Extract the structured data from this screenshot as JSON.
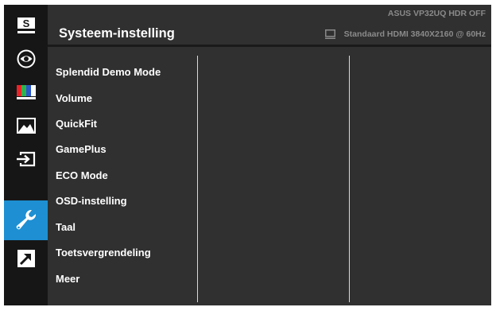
{
  "header": {
    "title": "Systeem-instelling",
    "model_line": "ASUS  VP32UQ  HDR OFF",
    "status_line": "Standaard HDMI 3840X2160 @ 60Hz",
    "status_icon": "monitor-icon"
  },
  "sidebar": {
    "items": [
      {
        "icon": "splendid-s-icon",
        "label": "S",
        "active": false
      },
      {
        "icon": "eye-care-icon",
        "active": false
      },
      {
        "icon": "color-bars-icon",
        "active": false
      },
      {
        "icon": "image-landscape-icon",
        "active": false
      },
      {
        "icon": "input-select-icon",
        "active": false
      },
      {
        "icon": "wrench-icon",
        "active": true
      },
      {
        "icon": "shortcut-arrow-icon",
        "active": false
      }
    ]
  },
  "menu": {
    "items": [
      {
        "label": "Splendid Demo Mode"
      },
      {
        "label": "Volume"
      },
      {
        "label": "QuickFit"
      },
      {
        "label": "GamePlus"
      },
      {
        "label": "ECO Mode"
      },
      {
        "label": "OSD-instelling"
      },
      {
        "label": "Taal"
      },
      {
        "label": "Toetsvergrendeling"
      },
      {
        "label": "Meer"
      }
    ]
  },
  "colors": {
    "background": "#303030",
    "sidebar": "#161616",
    "active": "#1e8fd2",
    "text": "#ffffff",
    "muted_text": "#8a8a8a"
  }
}
